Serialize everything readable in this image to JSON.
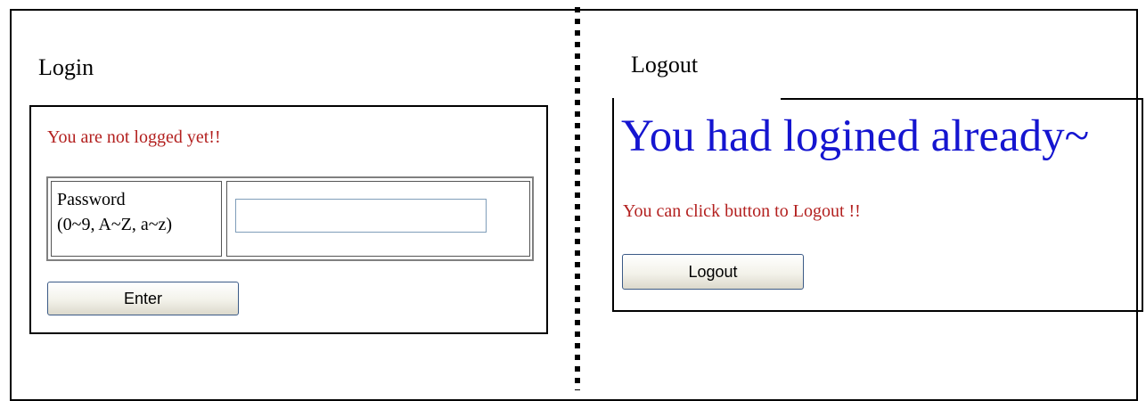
{
  "login": {
    "title": "Login",
    "status_message": "You are not logged yet!!",
    "password_label_line1": "Password",
    "password_label_line2": "(0~9, A~Z, a~z)",
    "password_value": "",
    "enter_label": "Enter"
  },
  "logout": {
    "title": "Logout",
    "heading": "You had logined already~",
    "instruction": "You can click button to Logout !!",
    "logout_label": "Logout"
  },
  "colors": {
    "status_red": "#b3201f",
    "heading_blue": "#1515d0",
    "input_border": "#7f9db9",
    "button_border": "#3b5a86"
  }
}
